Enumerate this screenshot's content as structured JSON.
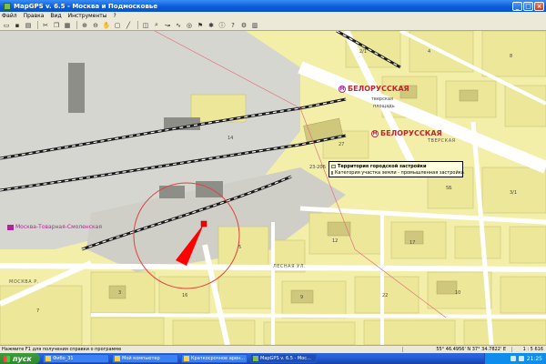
{
  "window": {
    "title": "MapGPS v. 6.5 - Москва и Подмосковье"
  },
  "menu": [
    "Файл",
    "Правка",
    "Вид",
    "Инструменты",
    "?"
  ],
  "toolbar_icons": [
    "open-icon",
    "save-icon",
    "print-icon",
    "cut-icon",
    "copy-icon",
    "paste-icon",
    "zoom-in-icon",
    "zoom-out-icon",
    "hand-icon",
    "select-icon",
    "ruler-icon",
    "layers-icon",
    "search-icon",
    "route-icon",
    "track-icon",
    "gps-icon",
    "waypoint-icon",
    "poi-icon",
    "info-icon",
    "help-icon",
    "settings-icon",
    "print-preview-icon"
  ],
  "map": {
    "metro": [
      {
        "name": "БЕЛОРУССКАЯ",
        "line": "pink"
      },
      {
        "name": "БЕЛОРУССКАЯ",
        "line": "red"
      }
    ],
    "metro_m": "M",
    "metro_sublabel": "тверская",
    "metro_sublabel2": "площадь",
    "rail_station": "Москва-Товарная-Смоленская",
    "tooltip": {
      "line1": "Территория городской застройки",
      "line2": "Категория участка земли - промышленная застройка"
    },
    "streets": [
      "МОСКВА Р.",
      "ЛЕСНАЯ УЛ.",
      "ТВЕРСКАЯ"
    ],
    "house_numbers": [
      "14",
      "2/1",
      "4",
      "8",
      "27",
      "23-20Б",
      "5Б",
      "3/1",
      "12",
      "17",
      "5",
      "3",
      "16",
      "9",
      "22",
      "10",
      "7"
    ],
    "colors": {
      "building": "#F4EFA8",
      "road": "#FFFFFF",
      "rail": "#1A1A1A",
      "industrial": "#D6D6D0",
      "metro_red": "#C0282D",
      "metro_pink": "#B0249A",
      "marker": "#FF0000"
    }
  },
  "statusbar": {
    "hint": "Нажмите F1 для получения справки о программе",
    "coords": "55° 46.4956' N  37° 34.7822' E",
    "scale": "1 : 5 616"
  },
  "taskbar": {
    "start": "пуск",
    "tasks": [
      {
        "label": "Фибо_31",
        "active": false
      },
      {
        "label": "Мой компьютер",
        "active": false
      },
      {
        "label": "Краткосрочное арен...",
        "active": false
      },
      {
        "label": "MapGPS v. 6.5 - Мос...",
        "active": true
      }
    ],
    "clock": "21:25"
  }
}
